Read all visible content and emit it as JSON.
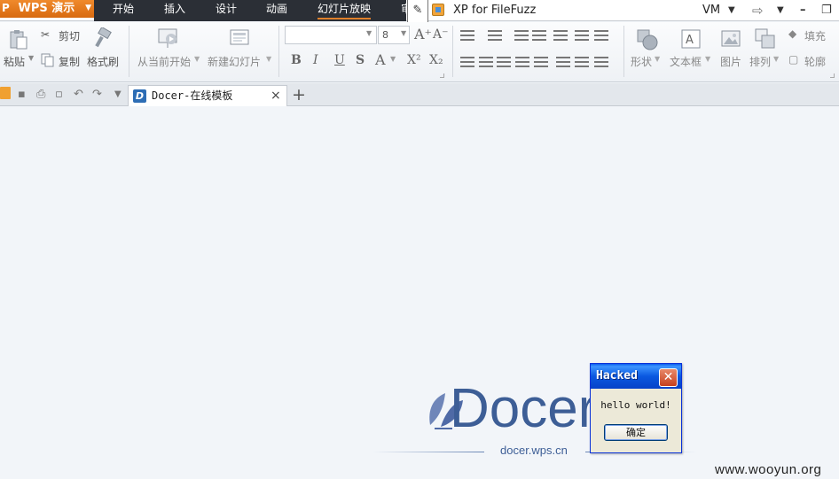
{
  "app": {
    "menu_label": "WPS 演示",
    "menu_tabs": [
      "开始",
      "插入",
      "设计",
      "动画",
      "幻灯片放映",
      "审"
    ],
    "active_tab": "幻灯片放映"
  },
  "window": {
    "title": "XP for FileFuzz",
    "vm_label": "VM"
  },
  "ribbon": {
    "clipboard": {
      "paste": "粘贴",
      "cut": "剪切",
      "copy": "复制",
      "format_painter": "格式刷"
    },
    "slides": {
      "from_current": "从当前开始",
      "new_slide": "新建幻灯片"
    },
    "font": {
      "name": "",
      "size": "8",
      "grow": "A⁺",
      "shrink": "A⁻",
      "bold": "B",
      "italic": "I",
      "underline": "U",
      "shadow": "S",
      "color": "A",
      "superscript": "X²",
      "subscript": "X₂"
    },
    "drawing": {
      "shape": "形状",
      "textbox": "文本框",
      "picture": "图片",
      "arrange": "排列",
      "fill": "填充",
      "outline": "轮廓"
    }
  },
  "tabs": {
    "doc_tab_label": "Docer-在线模板",
    "close": "×",
    "new": "+"
  },
  "content": {
    "logo_text": "Docer",
    "url": "docer.wps.cn"
  },
  "dialog": {
    "title": "Hacked",
    "message": "hello world!",
    "ok": "确定",
    "close": "✕"
  },
  "watermark": "www.wooyun.org",
  "colors": {
    "accent_orange": "#e0802a",
    "menu_dark": "#2b2f36",
    "docer_blue": "#3d5e96",
    "xp_title_blue": "#0a58e0"
  }
}
